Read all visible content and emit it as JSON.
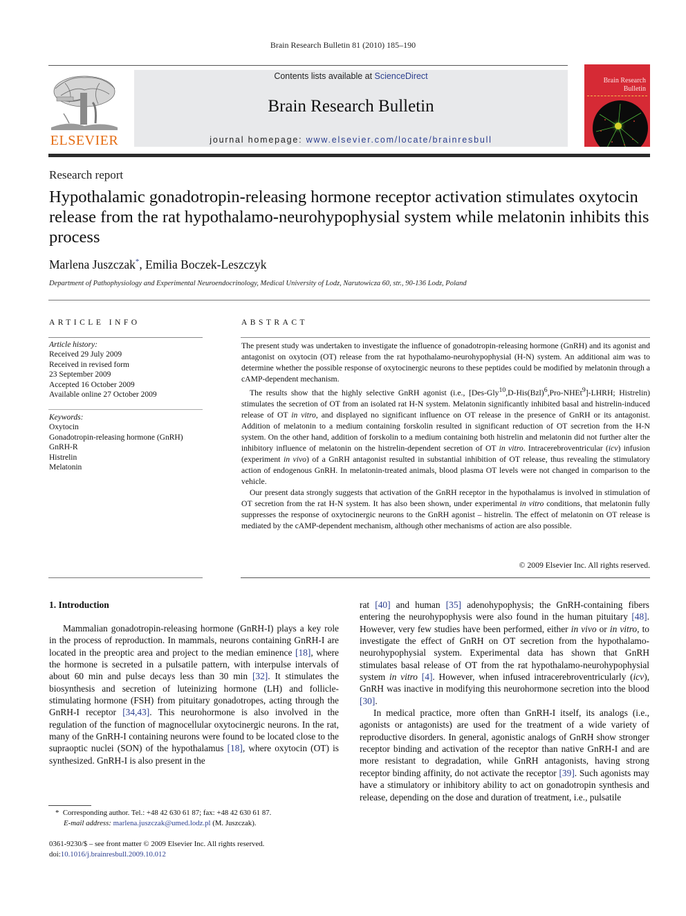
{
  "running_header": "Brain Research Bulletin 81 (2010) 185–190",
  "masthead": {
    "contents_prefix": "Contents lists available at ",
    "contents_link": "ScienceDirect",
    "journal_name": "Brain Research Bulletin",
    "homepage_prefix": "journal homepage: ",
    "homepage_link": "www.elsevier.com/locate/brainresbull",
    "publisher_logo_text": "ELSEVIER",
    "cover_title_line1": "Brain Research",
    "cover_title_line2": "Bulletin",
    "colors": {
      "publisher_orange": "#e46b12",
      "link_blue": "#2c3f8f",
      "cover_red": "#d62a35",
      "masthead_gray": "#e8e9eb"
    }
  },
  "article": {
    "type": "Research report",
    "title": "Hypothalamic gonadotropin-releasing hormone receptor activation stimulates oxytocin release from the rat hypothalamo-neurohypophysial system while melatonin inhibits this process",
    "authors": {
      "author1": "Marlena Juszczak",
      "author1_mark": "*",
      "separator": ", ",
      "author2": "Emilia Boczek-Leszczyk"
    },
    "affiliation": "Department of Pathophysiology and Experimental Neuroendocrinology, Medical University of Lodz, Narutowicza 60, str., 90-136 Lodz, Poland"
  },
  "article_info": {
    "heading": "ARTICLE INFO",
    "history_label": "Article history:",
    "history": [
      "Received 29 July 2009",
      "Received in revised form",
      "23 September 2009",
      "Accepted 16 October 2009",
      "Available online 27 October 2009"
    ],
    "keywords_label": "Keywords:",
    "keywords": [
      "Oxytocin",
      "Gonadotropin-releasing hormone (GnRH)",
      "GnRH-R",
      "Histrelin",
      "Melatonin"
    ]
  },
  "abstract": {
    "heading": "ABSTRACT",
    "p1": "The present study was undertaken to investigate the influence of gonadotropin-releasing hormone (GnRH) and its agonist and antagonist on oxytocin (OT) release from the rat hypothalamo-neurohypophysial (H-N) system. An additional aim was to determine whether the possible response of oxytocinergic neurons to these peptides could be modified by melatonin through a cAMP-dependent mechanism.",
    "p2_a": "The results show that the highly selective GnRH agonist (i.e., [Des-Gly",
    "p2_sup1": "10",
    "p2_b": ",D-His(Bzl)",
    "p2_sup2": "6",
    "p2_c": ",Pro-NHEt",
    "p2_sup3": "9",
    "p2_d": "]-LHRH; Histrelin) stimulates the secretion of OT from an isolated rat H-N system. Melatonin significantly inhibited basal and histrelin-induced release of OT ",
    "p2_i1": "in vitro",
    "p2_e": ", and displayed no significant influence on OT release in the presence of GnRH or its antagonist. Addition of melatonin to a medium containing forskolin resulted in significant reduction of OT secretion from the H-N system. On the other hand, addition of forskolin to a medium containing both histrelin and melatonin did not further alter the inhibitory influence of melatonin on the histrelin-dependent secretion of OT ",
    "p2_i2": "in vitro",
    "p2_f": ". Intracerebroventricular (",
    "p2_i3": "icv",
    "p2_g": ") infusion (experiment ",
    "p2_i4": "in vivo",
    "p2_h": ") of a GnRH antagonist resulted in substantial inhibition of OT release, thus revealing the stimulatory action of endogenous GnRH. In melatonin-treated animals, blood plasma OT levels were not changed in comparison to the vehicle.",
    "p3_a": "Our present data strongly suggests that activation of the GnRH receptor in the hypothalamus is involved in stimulation of OT secretion from the rat H-N system. It has also been shown, under experimental ",
    "p3_i1": "in vitro",
    "p3_b": " conditions, that melatonin fully suppresses the response of oxytocinergic neurons to the GnRH agonist – histrelin. The effect of melatonin on OT release is mediated by the cAMP-dependent mechanism, although other mechanisms of action are also possible.",
    "copyright": "© 2009 Elsevier Inc. All rights reserved."
  },
  "introduction": {
    "heading": "1.  Introduction",
    "left_p1_a": "Mammalian gonadotropin-releasing hormone (GnRH-I) plays a key role in the process of reproduction. In mammals, neurons containing GnRH-I are located in the preoptic area and project to the median eminence ",
    "ref_18a": "[18]",
    "left_p1_b": ", where the hormone is secreted in a pulsatile pattern, with interpulse intervals of about 60 min and pulse decays less than 30 min ",
    "ref_32": "[32]",
    "left_p1_c": ". It stimulates the biosynthesis and secretion of luteinizing hormone (LH) and follicle-stimulating hormone (FSH) from pituitary gonadotropes, acting through the GnRH-I receptor ",
    "ref_34_43": "[34,43]",
    "left_p1_d": ". This neurohormone is also involved in the regulation of the function of magnocellular oxytocinergic neurons. In the rat, many of the GnRH-I containing neurons were found to be located close to the supraoptic nuclei (SON) of the hypothalamus ",
    "ref_18b": "[18]",
    "left_p1_e": ", where oxytocin (OT) is synthesized. GnRH-I is also present in the",
    "right_p1_a": "rat ",
    "ref_40": "[40]",
    "right_p1_b": " and human ",
    "ref_35": "[35]",
    "right_p1_c": " adenohypophysis; the GnRH-containing fibers entering the neurohypophysis were also found in the human pituitary ",
    "ref_48": "[48]",
    "right_p1_d": ". However, very few studies have been performed, either ",
    "right_i1": "in vivo",
    "right_p1_e": " or ",
    "right_i2": "in vitro",
    "right_p1_f": ", to investigate the effect of GnRH on OT secretion from the hypothalamo-neurohypophysial system. Experimental data has shown that GnRH stimulates basal release of OT from the rat hypothalamo-neurohypophysial system ",
    "right_i3": "in vitro",
    "ref_4": "[4]",
    "right_p1_g": ". However, when infused intracerebroventricularly (",
    "right_i4": "icv",
    "right_p1_h": "), GnRH was inactive in modifying this neurohormone secretion into the blood ",
    "ref_30": "[30]",
    "right_p1_end": ".",
    "right_p2_a": "In medical practice, more often than GnRH-I itself, its analogs (i.e., agonists or antagonists) are used for the treatment of a wide variety of reproductive disorders. In general, agonistic analogs of GnRH show stronger receptor binding and activation of the receptor than native GnRH-I and are more resistant to degradation, while GnRH antagonists, having strong receptor binding affinity, do not activate the receptor ",
    "ref_39": "[39]",
    "right_p2_b": ". Such agonists may have a stimulatory or inhibitory ability to act on gonadotropin synthesis and release, depending on the dose and duration of treatment, i.e., pulsatile"
  },
  "footnote": {
    "mark": "*",
    "corresponding": "Corresponding author. Tel.: +48 42 630 61 87; fax: +48 42 630 61 87.",
    "email_label": "E-mail address: ",
    "email": "marlena.juszczak@umed.lodz.pl",
    "email_suffix": " (M. Juszczak)."
  },
  "front_matter": {
    "issn_line": "0361-9230/$ – see front matter © 2009 Elsevier Inc. All rights reserved.",
    "doi_prefix": "doi:",
    "doi": "10.1016/j.brainresbull.2009.10.012"
  }
}
